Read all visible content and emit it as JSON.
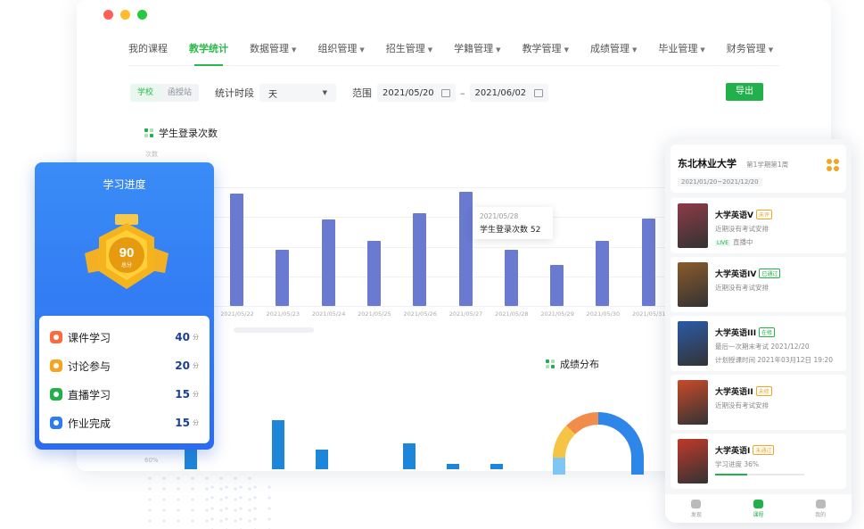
{
  "nav": {
    "items": [
      {
        "label": "我的课程",
        "caret": false,
        "active": false
      },
      {
        "label": "教学统计",
        "caret": false,
        "active": true
      },
      {
        "label": "数据管理",
        "caret": true,
        "active": false
      },
      {
        "label": "组织管理",
        "caret": true,
        "active": false
      },
      {
        "label": "招生管理",
        "caret": true,
        "active": false
      },
      {
        "label": "学籍管理",
        "caret": true,
        "active": false
      },
      {
        "label": "教学管理",
        "caret": true,
        "active": false
      },
      {
        "label": "成绩管理",
        "caret": true,
        "active": false
      },
      {
        "label": "毕业管理",
        "caret": true,
        "active": false
      },
      {
        "label": "财务管理",
        "caret": true,
        "active": false
      }
    ]
  },
  "filter": {
    "seg_school": "学校",
    "seg_station": "函授站",
    "period_label": "统计时段",
    "period_value": "天",
    "range_label": "范围",
    "date_from": "2021/05/20",
    "date_to": "2021/06/02",
    "export": "导出"
  },
  "login_chart": {
    "title": "学生登录次数",
    "yunit": "次数",
    "tooltip_date": "2021/05/28",
    "tooltip_text": "学生登录次数 52"
  },
  "chart_data": {
    "type": "bar",
    "title": "学生登录次数",
    "ylabel": "次数",
    "categories": [
      "2021/05/22",
      "2021/05/23",
      "2021/05/24",
      "2021/05/25",
      "2021/05/26",
      "2021/05/27",
      "2021/05/28",
      "2021/05/29",
      "2021/05/30",
      "2021/05/31"
    ],
    "values": [
      104,
      52,
      80,
      60,
      86,
      106,
      52,
      38,
      60,
      81
    ],
    "ylim": [
      0,
      110
    ],
    "grid": true
  },
  "low_chart": {
    "ylabel": "60%",
    "values": [
      0.55,
      0.95,
      0.38,
      0.5,
      0.1,
      0.1
    ]
  },
  "grade_chart": {
    "title": "成绩分布"
  },
  "progress": {
    "title": "学习进度",
    "score": "90",
    "score_unit": "总分",
    "items": [
      {
        "label": "课件学习",
        "value": "40",
        "unit": "分",
        "color": "#ff6a3d"
      },
      {
        "label": "讨论参与",
        "value": "20",
        "unit": "分",
        "color": "#f5a524"
      },
      {
        "label": "直播学习",
        "value": "15",
        "unit": "分",
        "color": "#22b04b"
      },
      {
        "label": "作业完成",
        "value": "15",
        "unit": "分",
        "color": "#2f7bf0"
      }
    ]
  },
  "phone": {
    "university": "东北林业大学",
    "term": "第1学期第1周",
    "range": "2021/01/20~2021/12/20",
    "courses": [
      {
        "name": "大学英语V",
        "tag": "未评",
        "tag_color": "#f0a524",
        "line1": "近期没有考试安排",
        "live": "LIVE",
        "line2": "直播中",
        "cover": "#8e3b46"
      },
      {
        "name": "大学英语IV",
        "tag": "已通过",
        "tag_color": "#22b04b",
        "line1": "近期没有考试安排",
        "cover": "#8a5a2b"
      },
      {
        "name": "大学英语III",
        "tag": "在修",
        "tag_color": "#22b04b",
        "line1": "最后一次期末考试 2021/12/20",
        "line2": "计划授课时间 2021年03月12日 19:20",
        "cover": "#2b5aa8"
      },
      {
        "name": "大学英语II",
        "tag": "未修",
        "tag_color": "#f0a524",
        "line1": "近期没有考试安排",
        "cover": "#c94a2a"
      },
      {
        "name": "大学英语I",
        "tag": "未通过",
        "tag_color": "#f0a524",
        "line1": "学习进度 36%",
        "progress": 0.36,
        "cover": "#c0392b"
      }
    ],
    "tabs": [
      {
        "label": "发现",
        "active": false
      },
      {
        "label": "课程",
        "active": true
      },
      {
        "label": "我的",
        "active": false
      }
    ]
  },
  "colors": {
    "accent": "#22b04b",
    "bar": "#6a7ad0",
    "progress_bg": "#2f7bf0"
  }
}
